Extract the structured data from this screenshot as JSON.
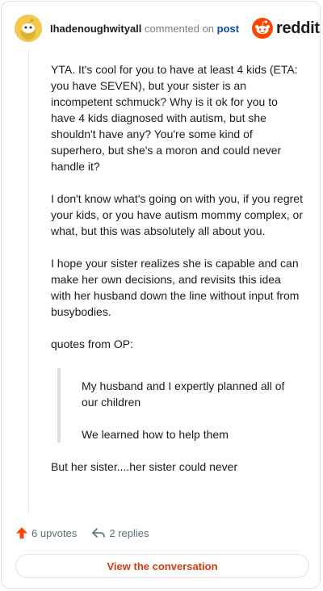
{
  "header": {
    "username": "Ihadenoughwityall",
    "action_text": "commented on",
    "post_link": "post",
    "brand": "reddit"
  },
  "comment": {
    "paragraphs": [
      "YTA. It's cool for you to have at least 4 kids (ETA: you have SEVEN), but your sister is an incompetent schmuck? Why is it ok for you to have 4 kids diagnosed with autism, but she shouldn't have any? You're some kind of superhero, but she's a moron and could never handle it?",
      "I don't know what's going on with you, if you regret your kids, or you have autism mommy complex, or what, but this was absolutely all about you.",
      "I hope your sister realizes she is capable and can make her own decisions, and revisits this idea with her husband down the line without input from busybodies.",
      "quotes from OP:"
    ],
    "quotes": [
      "My husband and I expertly planned all of our children",
      "We learned how to help them"
    ],
    "closing": "But her sister....her sister could never"
  },
  "actions": {
    "upvotes": "6 upvotes",
    "replies": "2 replies"
  },
  "view_button": "View the conversation",
  "colors": {
    "brand_orange": "#ff4500",
    "link_blue": "#0a4da8",
    "button_text": "#d23d0d"
  },
  "icons": [
    "snoo-avatar-icon",
    "reddit-logo-icon",
    "upvote-arrow-icon",
    "reply-arrow-icon"
  ]
}
